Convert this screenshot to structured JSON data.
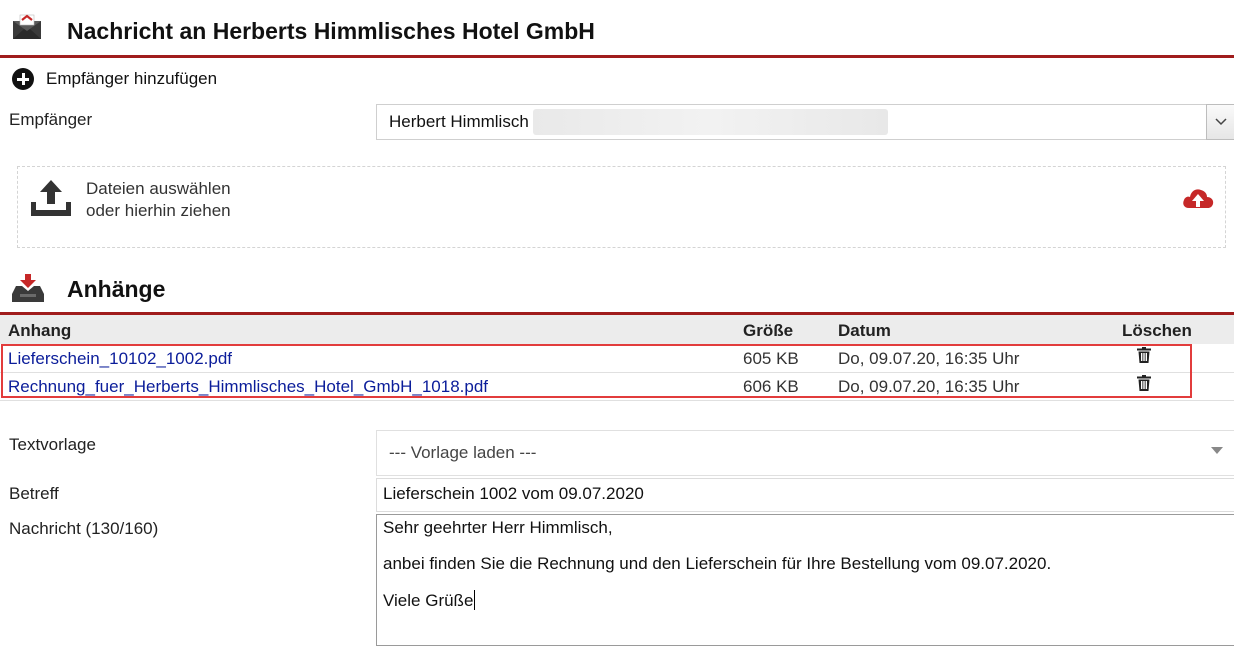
{
  "header": {
    "title": "Nachricht an Herberts Himmlisches Hotel GmbH",
    "icon": "envelope-icon",
    "accent_color": "#a01c1c"
  },
  "add_recipient": {
    "label": "Empfänger hinzufügen",
    "icon": "plus-circle-icon"
  },
  "recipient": {
    "label": "Empfänger",
    "value": "Herbert Himmlisch"
  },
  "upload": {
    "line1": "Dateien auswählen",
    "line2": "oder hierhin ziehen",
    "icon": "upload-icon",
    "cloud_icon": "cloud-upload-icon"
  },
  "attachments": {
    "title": "Anhänge",
    "icon": "download-tray-icon",
    "columns": [
      "Anhang",
      "Größe",
      "Datum",
      "Löschen"
    ],
    "rows": [
      {
        "name": "Lieferschein_10102_1002.pdf",
        "size": "605 KB",
        "date": "Do, 09.07.20, 16:35 Uhr"
      },
      {
        "name": "Rechnung_fuer_Herberts_Himmlisches_Hotel_GmbH_1018.pdf",
        "size": "606 KB",
        "date": "Do, 09.07.20, 16:35 Uhr"
      }
    ]
  },
  "form": {
    "template_label": "Textvorlage",
    "template_value": "--- Vorlage laden ---",
    "subject_label": "Betreff",
    "subject_value": "Lieferschein 1002 vom 09.07.2020",
    "message_label": "Nachricht (130/160)",
    "message_lines": [
      "Sehr geehrter Herr Himmlisch,",
      "anbei finden Sie die Rechnung und den Lieferschein für Ihre Bestellung vom 09.07.2020.",
      "Viele Grüße"
    ]
  },
  "highlight_color": "#e23c3c"
}
